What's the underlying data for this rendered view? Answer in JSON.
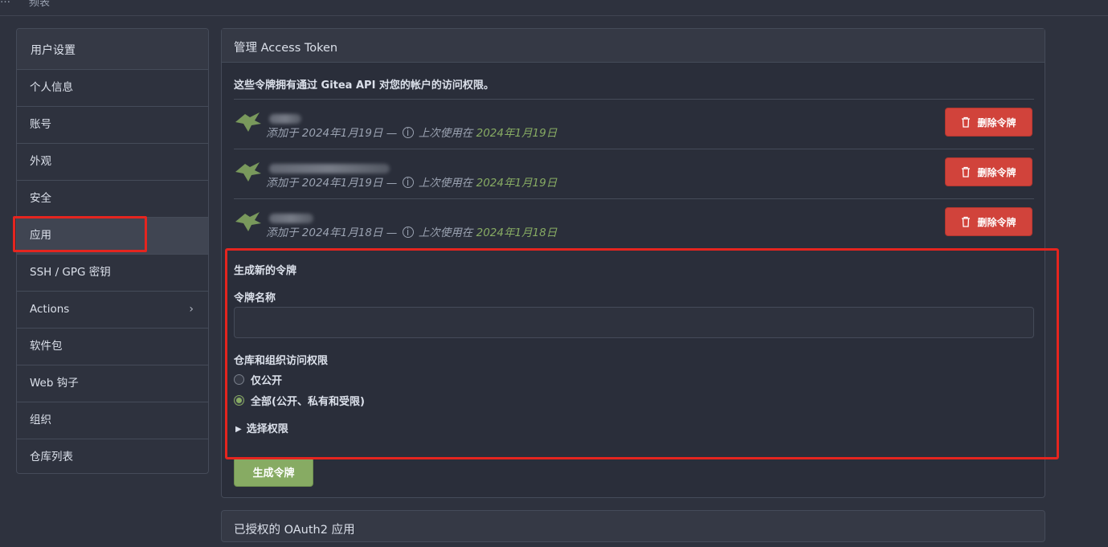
{
  "topbar": {
    "crumb1": "…",
    "crumb2": "频表"
  },
  "sidebar": {
    "header": "用户设置",
    "items": [
      {
        "label": "个人信息"
      },
      {
        "label": "账号"
      },
      {
        "label": "外观"
      },
      {
        "label": "安全"
      },
      {
        "label": "应用",
        "active": true
      },
      {
        "label": "SSH / GPG 密钥"
      },
      {
        "label": "Actions",
        "chevron": "›"
      },
      {
        "label": "软件包"
      },
      {
        "label": "Web 钩子"
      },
      {
        "label": "组织"
      },
      {
        "label": "仓库列表"
      }
    ]
  },
  "tokens_panel": {
    "title": "管理 Access Token",
    "description": "这些令牌拥有通过 Gitea API 对您的帐户的访问权限。",
    "tokens": [
      {
        "added": "添加于 2024年1月19日 —",
        "last_used_label": "上次使用在",
        "last_used": "2024年1月19日",
        "delete_label": "删除令牌"
      },
      {
        "added": "添加于 2024年1月19日 —",
        "last_used_label": "上次使用在",
        "last_used": "2024年1月19日",
        "delete_label": "删除令牌"
      },
      {
        "added": "添加于 2024年1月18日 —",
        "last_used_label": "上次使用在",
        "last_used": "2024年1月18日",
        "delete_label": "删除令牌"
      }
    ]
  },
  "generate": {
    "title": "生成新的令牌",
    "name_label": "令牌名称",
    "name_value": "",
    "perm_label": "仓库和组织访问权限",
    "options": [
      {
        "label": "仅公开",
        "checked": false
      },
      {
        "label": "全部(公开、私有和受限)",
        "checked": true
      }
    ],
    "select_perms": "选择权限",
    "submit_label": "生成令牌"
  },
  "oauth_panel": {
    "title": "已授权的 OAuth2 应用"
  },
  "colors": {
    "accent_green": "#87ab63",
    "danger_red": "#d1433b",
    "highlight_red": "#e5251f"
  },
  "icons": {
    "token": "key-icon",
    "delete": "trash-icon",
    "info": "info-icon"
  }
}
